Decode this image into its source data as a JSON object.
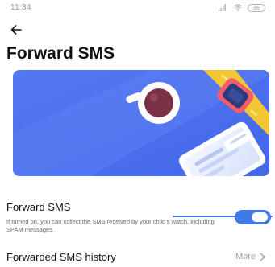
{
  "status_bar": {
    "time": "11:34",
    "battery": "86",
    "signal_icon": "signal-icon",
    "wifi_icon": "wifi-icon"
  },
  "header": {
    "back_icon": "arrow-left-icon",
    "title": "Forward SMS"
  },
  "hero": {
    "background_color": "#4b6ff0",
    "illustration": "sms-forward-watch-phone-illustration"
  },
  "forward_setting": {
    "label": "Forward SMS",
    "description": "If turned on, you can collect the SMS received by your child's watch, including SPAM messages.",
    "enabled": true,
    "accent_color": "#3f7ae8"
  },
  "history": {
    "label": "Forwarded SMS history",
    "more_label": "More",
    "chevron_icon": "chevron-right-icon"
  }
}
